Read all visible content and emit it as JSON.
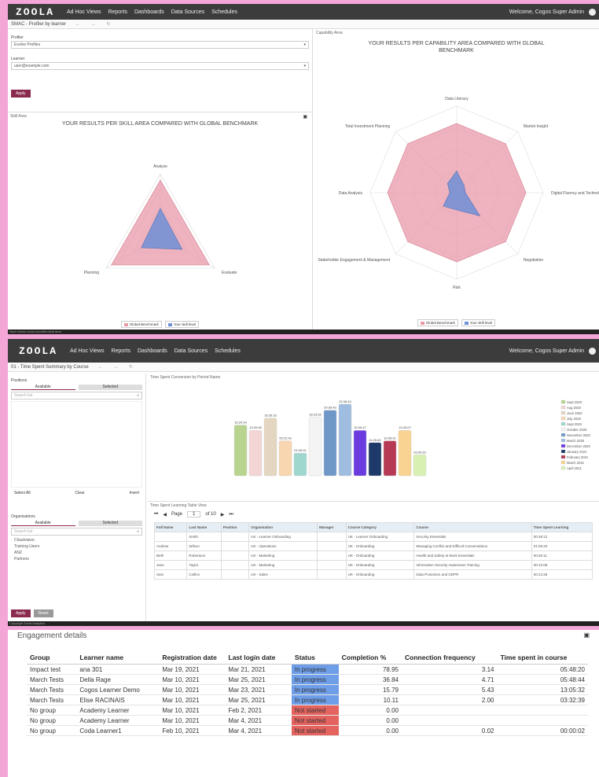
{
  "app": {
    "logo": "ZOOLA",
    "nav": [
      "Ad Hoc Views",
      "Reports",
      "Dashboards",
      "Data Sources",
      "Schedules"
    ],
    "welcome": "Welcome, Cogos Super Admin"
  },
  "shot1": {
    "breadcrumb": "SMAC - Profiler by learner",
    "filters": {
      "profile_label": "Profiler",
      "profile_value": "Evolve Profiles",
      "learner_label": "Learner",
      "learner_value": "user@example.com",
      "apply": "Apply"
    },
    "skill_panel_title": "Skill Area",
    "skill_chart_title": "YOUR RESULTS PER SKILL AREA COMPARED WITH GLOBAL BENCHMARK",
    "skill_axes": [
      "Analyse",
      "Evaluate",
      "Planning"
    ],
    "capability_panel_title": "Capability Area",
    "capability_chart_title": "YOUR RESULTS PER CAPABILITY AREA COMPARED WITH GLOBAL BENCHMARK",
    "capability_axes": [
      "Data Literacy",
      "Market Insight",
      "Digital Fluency and Technology",
      "Negotiation",
      "Risk",
      "Stakeholder Engagement & Management",
      "Data Analysis",
      "Total Investment Planning"
    ],
    "legend": [
      "Global Benchmark",
      "Your skill level"
    ],
    "colors": {
      "benchmark": "#e89aa8",
      "yours": "#6f8fd6"
    },
    "status_url": "https://www.zoola.io/profiler/skill-area"
  },
  "shot2": {
    "breadcrumb": "01 - Time Spent Summary by Course",
    "positions_label": "Positions",
    "tabs": [
      "Available",
      "Selected"
    ],
    "search_placeholder": "Search list",
    "list_controls": [
      "Select All",
      "Clear",
      "Invert"
    ],
    "organisations_label": "Organisations",
    "org_items": [
      "Cloudvision",
      "Training Users",
      "ANZ",
      "Partners"
    ],
    "apply": "Apply",
    "reset": "Reset",
    "chart_panel_title": "Time Spent Conversion by Period Name",
    "table_panel_title": "Time Spent Learning Table View",
    "page_label": "Page",
    "page_value": "1",
    "page_total": "of 10",
    "legend": [
      "Sept 2020",
      "Aug 2020",
      "June 2020",
      "July 2020",
      "Sept 2020",
      "October 2020",
      "November 2020",
      "March 2020",
      "December 2020",
      "January 2021",
      "February 2021",
      "March 2021",
      "April 2021"
    ],
    "table_headers": [
      "Full Name",
      "Last Name",
      "Position",
      "Organisation",
      "Manager",
      "Course Category",
      "Course",
      "Time Spent Learning"
    ],
    "table_rows": [
      [
        "",
        "Smith",
        "",
        "UK - Learner Onboarding",
        "",
        "UK - Learner Onboarding",
        "Security Essentials",
        "00:48:12"
      ],
      [
        "Andrew",
        "Wilson",
        "",
        "UK - Operations",
        "",
        "UK - Onboarding",
        "Managing Conflict and Difficult Conversations",
        "01:08:20"
      ],
      [
        "Beth",
        "Robertson",
        "",
        "UK - Marketing",
        "",
        "UK - Onboarding",
        "Health and Safety at Work Essentials",
        "00:46:11"
      ],
      [
        "Jane",
        "Taylor",
        "",
        "UK - Marketing",
        "",
        "UK - Onboarding",
        "Information Security Awareness Training",
        "00:12:08"
      ],
      [
        "Sam",
        "Collins",
        "",
        "UK - Sales",
        "",
        "UK - Onboarding",
        "Data Protection and GDPR",
        "00:14:28"
      ]
    ],
    "status_url": "Copyright Zoola Analytics"
  },
  "shot3": {
    "title": "Engagement details",
    "headers": [
      "Group",
      "Learner name",
      "Registration date",
      "Last login date",
      "Status",
      "Completion %",
      "Connection frequency",
      "Time spent in course"
    ],
    "rows": [
      [
        "Impact test",
        "ana 301",
        "Mar 19, 2021",
        "Mar 21, 2021",
        "In progress",
        "78.95",
        "3.14",
        "05:48:20"
      ],
      [
        "March Tests",
        "Della Rage",
        "Mar 10, 2021",
        "Mar 25, 2021",
        "In progress",
        "36.84",
        "4.71",
        "05:48:44"
      ],
      [
        "March Tests",
        "Cogos Learner Demo",
        "Mar 10, 2021",
        "Mar 23, 2021",
        "In progress",
        "15.79",
        "5.43",
        "13:05:32"
      ],
      [
        "March Tests",
        "Elise RACINAIS",
        "Mar 10, 2021",
        "Mar 25, 2021",
        "In progress",
        "10.11",
        "2.00",
        "03:32:39"
      ],
      [
        "No group",
        "Academy Learner",
        "Mar 10, 2021",
        "Feb 2, 2021",
        "Not started",
        "0.00",
        "",
        ""
      ],
      [
        "No group",
        "Academy Learner",
        "Mar 10, 2021",
        "Mar 4, 2021",
        "Not started",
        "0.00",
        "",
        ""
      ],
      [
        "No group",
        "Coda Learner1",
        "Feb 10, 2021",
        "Mar 4, 2021",
        "Not started",
        "0.00",
        "0.02",
        "00:00:02"
      ]
    ]
  },
  "chart_data": [
    {
      "type": "radar",
      "title": "YOUR RESULTS PER SKILL AREA COMPARED WITH GLOBAL BENCHMARK",
      "categories": [
        "Analyse",
        "Evaluate",
        "Planning"
      ],
      "series": [
        {
          "name": "Global Benchmark",
          "values": [
            90,
            90,
            90
          ]
        },
        {
          "name": "Your skill level",
          "values": [
            45,
            40,
            35
          ]
        }
      ],
      "ylim": [
        0,
        100
      ]
    },
    {
      "type": "radar",
      "title": "YOUR RESULTS PER CAPABILITY AREA COMPARED WITH GLOBAL BENCHMARK",
      "categories": [
        "Data Literacy",
        "Market Insight",
        "Digital Fluency and Technology",
        "Negotiation",
        "Risk",
        "Stakeholder Engagement & Management",
        "Data Analysis",
        "Total Investment Planning"
      ],
      "series": [
        {
          "name": "Global Benchmark",
          "values": [
            80,
            80,
            80,
            80,
            80,
            80,
            80,
            80
          ]
        },
        {
          "name": "Your skill level",
          "values": [
            25,
            12,
            10,
            38,
            20,
            22,
            8,
            15
          ]
        }
      ],
      "ylim": [
        0,
        100
      ]
    },
    {
      "type": "bar",
      "title": "Time Spent Conversion by Period Name",
      "categories": [
        "Sept 2020",
        "Aug 2020",
        "June 2020",
        "July 2020",
        "Sept 2020",
        "October 2020",
        "November 2020",
        "March 2020",
        "December 2020",
        "January 2021",
        "February 2021",
        "March 2021",
        "April 2021"
      ],
      "values": [
        58,
        52,
        66,
        40,
        26,
        67,
        75,
        82,
        52,
        38,
        40,
        52,
        24
      ],
      "labels": [
        "15:24:14",
        "13:20:06",
        "16:35:16",
        "05:22:43",
        "01:09:01",
        "16:23:52",
        "20:35:43",
        "22:38:43",
        "15:05:47",
        "11:20:40",
        "10:06:01",
        "13:43:07",
        "03:00:15"
      ],
      "colors": [
        "#b9d48f",
        "#f4d5d5",
        "#e4d6c0",
        "#f7d6b0",
        "#9fd7cf",
        "#f4f4f4",
        "#6f98c9",
        "#9fbde0",
        "#6b3be0",
        "#1e3a6a",
        "#b73a55",
        "#f9d391",
        "#d9f0b3"
      ],
      "ylim": [
        0,
        90
      ]
    }
  ]
}
